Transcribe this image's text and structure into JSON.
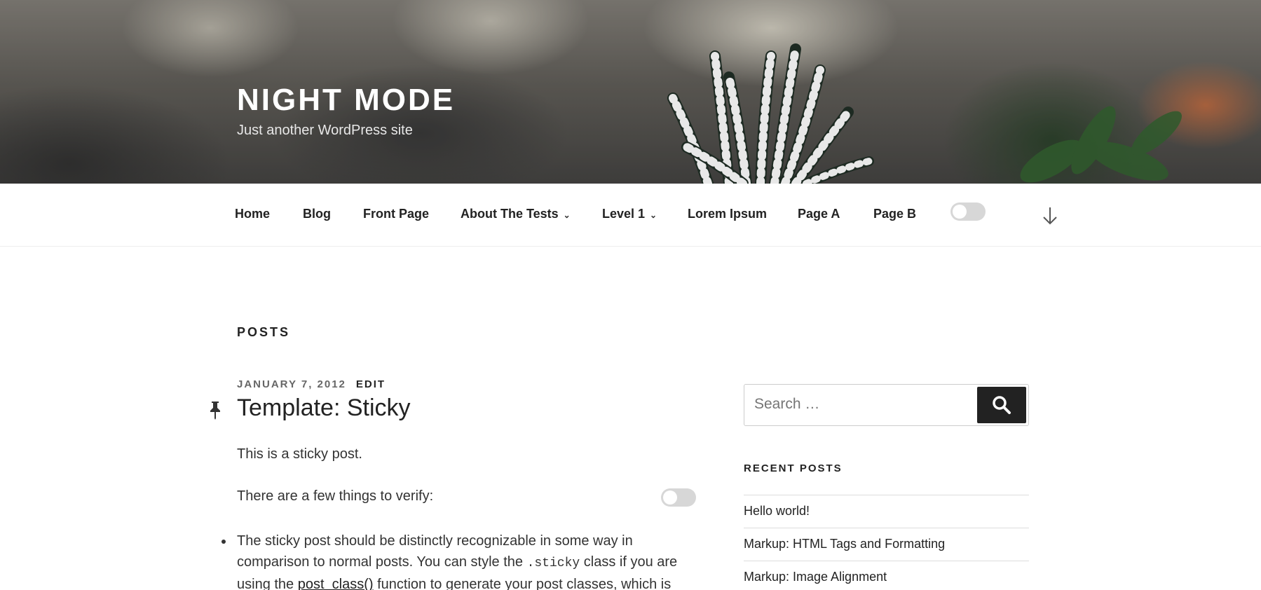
{
  "header": {
    "site_title": "NIGHT MODE",
    "site_description": "Just another WordPress site"
  },
  "nav": {
    "items": [
      {
        "label": "Home"
      },
      {
        "label": "Blog"
      },
      {
        "label": "Front Page"
      },
      {
        "label": "About The Tests"
      },
      {
        "label": "Level 1"
      },
      {
        "label": "Lorem Ipsum"
      },
      {
        "label": "Page A"
      },
      {
        "label": "Page B"
      }
    ],
    "night_mode_toggle": "off"
  },
  "main": {
    "heading": "POSTS",
    "post": {
      "date": "JANUARY 7, 2012",
      "edit_label": "EDIT",
      "title": "Template: Sticky",
      "paragraph1": "This is a sticky post.",
      "paragraph2": "There are a few things to verify:",
      "bullet_part1": "The sticky post should be distinctly recognizable in some way in comparison to normal posts. You can style the ",
      "bullet_code": ".sticky",
      "bullet_part2": " class if you are using the ",
      "bullet_link": "post_class()",
      "bullet_part3": " function to generate your post classes, which is"
    }
  },
  "sidebar": {
    "search": {
      "placeholder": "Search …"
    },
    "recent_posts": {
      "title": "RECENT POSTS",
      "items": [
        {
          "label": "Hello world!"
        },
        {
          "label": "Markup: HTML Tags and Formatting"
        },
        {
          "label": "Markup: Image Alignment"
        }
      ]
    }
  },
  "colors": {
    "text": "#222222",
    "muted": "#666666",
    "toggle_track": "#d7d7d7",
    "search_button": "#222222"
  }
}
